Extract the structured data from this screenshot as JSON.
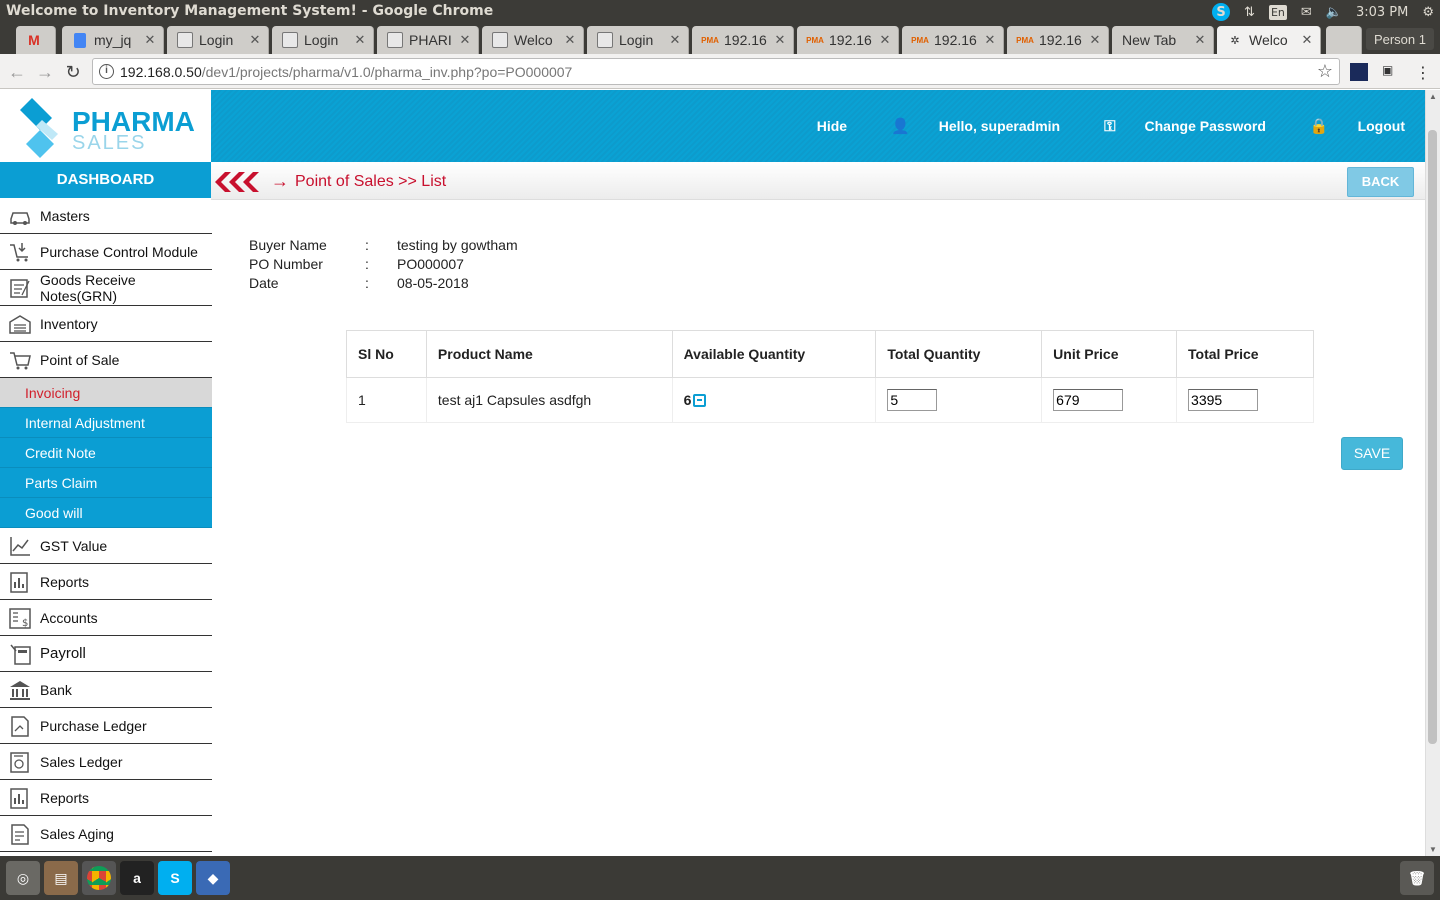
{
  "os": {
    "window_title": "Welcome to Inventory Management System! - Google Chrome",
    "language": "En",
    "time": "3:03 PM"
  },
  "browser": {
    "tabs": [
      {
        "label": "",
        "icon": "gmail-icon"
      },
      {
        "label": "my_jq",
        "icon": "doc-icon"
      },
      {
        "label": "Login",
        "icon": "page-icon"
      },
      {
        "label": "Login",
        "icon": "page-icon"
      },
      {
        "label": "PHARI",
        "icon": "page-icon"
      },
      {
        "label": "Welco",
        "icon": "page-icon"
      },
      {
        "label": "Login",
        "icon": "page-icon"
      },
      {
        "label": "192.16",
        "icon": "pma-icon"
      },
      {
        "label": "192.16",
        "icon": "pma-icon"
      },
      {
        "label": "192.16",
        "icon": "pma-icon"
      },
      {
        "label": "192.16",
        "icon": "pma-icon"
      },
      {
        "label": "New Tab",
        "icon": ""
      },
      {
        "label": "Welco",
        "icon": "page-icon",
        "active": true
      }
    ],
    "person": "Person 1",
    "url_host": "192.168.0.50",
    "url_path": "/dev1/projects/pharma/v1.0/pharma_inv.php?po=PO000007"
  },
  "app": {
    "logo_top": "PHARMA",
    "logo_bottom": "SALES",
    "header_links": {
      "hide": "Hide",
      "hello": "Hello, superadmin",
      "change_password": "Change Password",
      "logout": "Logout"
    },
    "dashboard_label": "DASHBOARD",
    "breadcrumb": "Point of Sales >> List",
    "back_label": "BACK",
    "save_label": "SAVE",
    "sidebar_top": [
      {
        "label": "Masters",
        "icon": "car-icon"
      },
      {
        "label": "Purchase Control Module",
        "icon": "cart-download-icon"
      },
      {
        "label": "Goods Receive Notes(GRN)",
        "icon": "notes-icon"
      },
      {
        "label": "Inventory",
        "icon": "warehouse-icon"
      },
      {
        "label": "Point of Sale",
        "icon": "cart-icon"
      }
    ],
    "sidebar_sub": [
      {
        "label": "Invoicing",
        "active": true
      },
      {
        "label": "Internal Adjustment"
      },
      {
        "label": "Credit Note"
      },
      {
        "label": "Parts Claim"
      },
      {
        "label": "Good will"
      }
    ],
    "sidebar_bottom": [
      {
        "label": "GST Value",
        "icon": "line-chart-icon"
      },
      {
        "label": "Reports",
        "icon": "report-icon"
      },
      {
        "label": "Accounts",
        "icon": "accounts-icon"
      },
      {
        "label": "Payroll",
        "icon": "calculator-icon"
      },
      {
        "label": "Bank",
        "icon": "bank-icon"
      },
      {
        "label": "Purchase Ledger",
        "icon": "ledger-icon"
      },
      {
        "label": "Sales Ledger",
        "icon": "sales-ledger-icon"
      },
      {
        "label": "Reports",
        "icon": "report-icon"
      },
      {
        "label": "Sales Aging",
        "icon": "aging-icon"
      }
    ],
    "details": [
      {
        "label": "Buyer Name",
        "sep": ":",
        "value": "testing by gowtham"
      },
      {
        "label": "PO Number",
        "sep": ":",
        "value": "PO000007"
      },
      {
        "label": "Date",
        "sep": ":",
        "value": "08-05-2018"
      }
    ],
    "table": {
      "headers": [
        "Sl No",
        "Product Name",
        "Available Quantity",
        "Total Quantity",
        "Unit Price",
        "Total Price"
      ],
      "rows": [
        {
          "sl": "1",
          "product": "test aj1 Capsules asdfgh",
          "available": "6",
          "total_qty": "5",
          "unit_price": "679",
          "total_price": "3395"
        }
      ]
    }
  }
}
